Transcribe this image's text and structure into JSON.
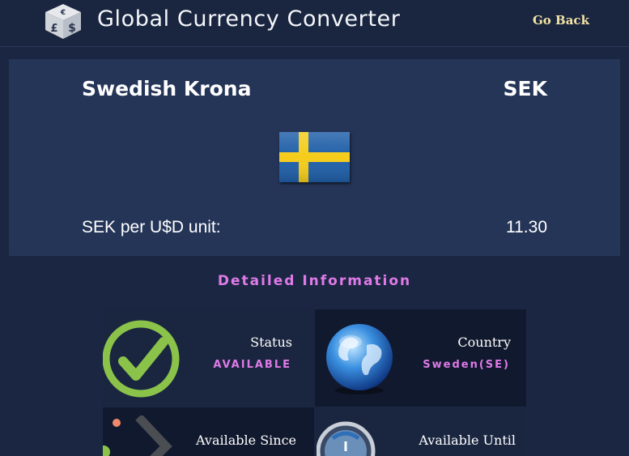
{
  "header": {
    "title": "Global Currency Converter",
    "go_back_label": "Go Back",
    "logo_icon": "currency-cube-icon"
  },
  "currency": {
    "name": "Swedish Krona",
    "code": "SEK",
    "flag_icon": "sweden-flag-icon",
    "rate_label": "SEK per U$D unit:",
    "rate_value": "11.30"
  },
  "details": {
    "title": "Detailed Information",
    "status": {
      "label": "Status",
      "value": "AVAILABLE",
      "icon": "checkmark-icon"
    },
    "country": {
      "label": "Country",
      "value": "Sweden(SE)",
      "icon": "globe-icon"
    },
    "since": {
      "label": "Available Since",
      "icon": "timeline-icon"
    },
    "until": {
      "label": "Available Until",
      "icon": "clock-icon"
    }
  },
  "colors": {
    "background": "#1b2742",
    "card": "#253558",
    "accent": "#e07ae8",
    "go_back": "#f3e3a6",
    "check_green": "#8bc34a"
  }
}
